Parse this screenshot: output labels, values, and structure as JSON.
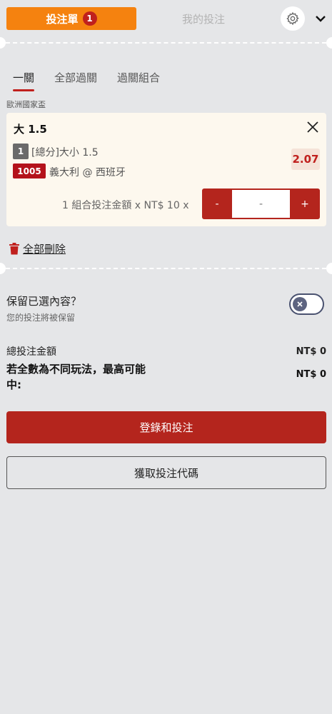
{
  "header": {
    "tab_betslip": "投注單",
    "betslip_count": "1",
    "tab_my_bets": "我的投注",
    "settings_icon": "gear-icon",
    "collapse_icon": "chevron-down-icon"
  },
  "subtabs": {
    "single": "一關",
    "all_parlay": "全部過關",
    "parlay_combo": "過關組合"
  },
  "league": "歐洲國家盃",
  "bet": {
    "selection_prefix": "大",
    "selection_line": "1.5",
    "market_num": "1",
    "market_label": "[總分]大小 1.5",
    "match_num": "1005",
    "match_label": "義大利 @ 西班牙",
    "odds": "2.07",
    "stake_label": "1 組合投注金額 x NT$ 10 x",
    "minus_label": "-",
    "stake_placeholder": "-",
    "plus_label": "+"
  },
  "actions": {
    "delete_all": "全部刪除"
  },
  "keep": {
    "question": "保留已選內容？",
    "sub": "您的投注將被保留",
    "toggle_on": false
  },
  "totals": {
    "total_label": "總投注金額",
    "total_value": "NT$ 0",
    "max_win_label": "若全數為不同玩法，最高可能中:",
    "max_win_value": "NT$ 0"
  },
  "buttons": {
    "login_bet": "登錄和投注",
    "get_code": "獲取投注代碼"
  },
  "colors": {
    "accent_orange": "#f5820f",
    "brand_red": "#b4251d",
    "background": "#e5e6e8"
  }
}
